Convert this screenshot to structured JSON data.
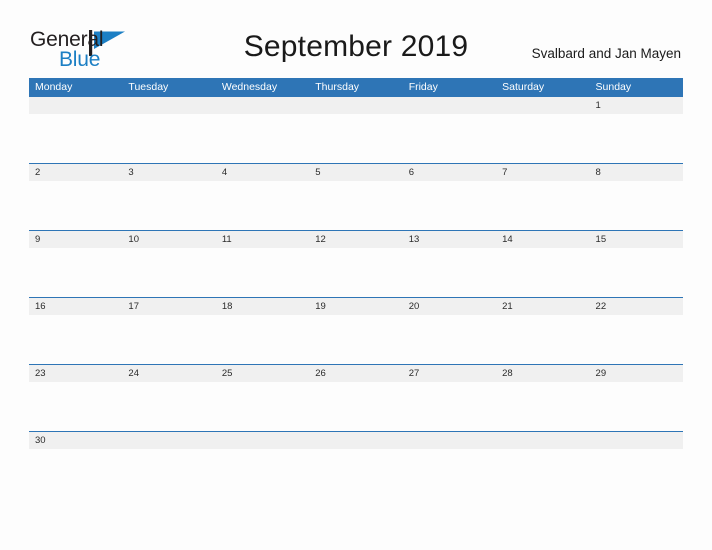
{
  "brand": {
    "name_part1": "General",
    "name_part2": "Blue",
    "flag_icon": "blue-flag-triangle-icon",
    "color_dark": "#231f20",
    "color_blue": "#1c7fc4"
  },
  "header": {
    "title": "September 2019",
    "subtitle": "Svalbard and Jan Mayen"
  },
  "colors": {
    "header_blue": "#2e75b6",
    "date_band_gray": "#f0f0f0",
    "page_background": "#fdfdfd",
    "text_dark": "#1a1a1a"
  },
  "calendar": {
    "month": "September",
    "year": "2019",
    "weekday_headers": [
      "Monday",
      "Tuesday",
      "Wednesday",
      "Thursday",
      "Friday",
      "Saturday",
      "Sunday"
    ],
    "weeks": [
      [
        "",
        "",
        "",
        "",
        "",
        "",
        "1"
      ],
      [
        "2",
        "3",
        "4",
        "5",
        "6",
        "7",
        "8"
      ],
      [
        "9",
        "10",
        "11",
        "12",
        "13",
        "14",
        "15"
      ],
      [
        "16",
        "17",
        "18",
        "19",
        "20",
        "21",
        "22"
      ],
      [
        "23",
        "24",
        "25",
        "26",
        "27",
        "28",
        "29"
      ],
      [
        "30",
        "",
        "",
        "",
        "",
        "",
        ""
      ]
    ]
  }
}
